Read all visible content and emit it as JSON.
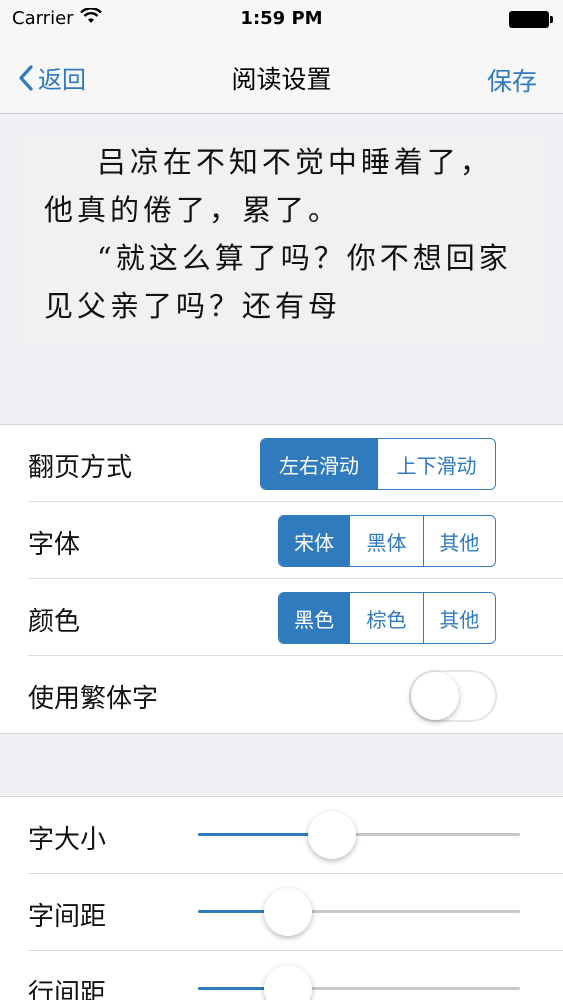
{
  "status_bar": {
    "carrier": "Carrier",
    "time": "1:59 PM"
  },
  "nav": {
    "back_label": "返回",
    "title": "阅读设置",
    "save_label": "保存"
  },
  "preview": {
    "text": "    吕凉在不知不觉中睡着了，他真的倦了，累了。\n    “就这么算了吗？你不想回家见父亲了吗？还有母"
  },
  "settings": {
    "page_turn": {
      "label": "翻页方式",
      "options": [
        "左右滑动",
        "上下滑动"
      ],
      "selected": 0
    },
    "font": {
      "label": "字体",
      "options": [
        "宋体",
        "黑体",
        "其他"
      ],
      "selected": 0
    },
    "color": {
      "label": "颜色",
      "options": [
        "黑色",
        "棕色",
        "其他"
      ],
      "selected": 0
    },
    "traditional": {
      "label": "使用繁体字",
      "on": false
    }
  },
  "sliders": {
    "font_size": {
      "label": "字大小",
      "value": 0.4
    },
    "letter_spacing": {
      "label": "字间距",
      "value": 0.24
    },
    "line_spacing": {
      "label": "行间距",
      "value": 0.24
    }
  },
  "colors": {
    "accent": "#2f7bbd"
  }
}
